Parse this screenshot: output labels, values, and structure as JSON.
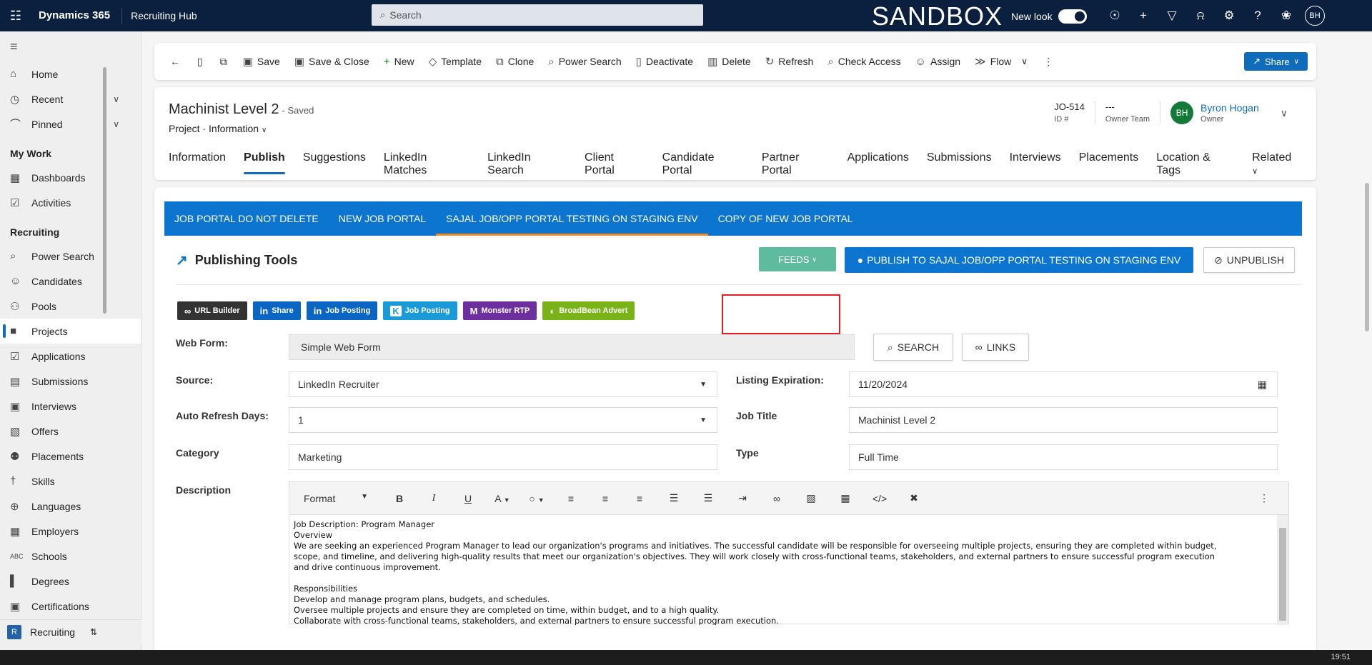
{
  "topbar": {
    "app_name": "Dynamics 365",
    "hub_name": "Recruiting Hub",
    "search_placeholder": "Search",
    "env_label": "SANDBOX",
    "new_look_label": "New look",
    "new_look_on": true,
    "user_initials": "BH"
  },
  "sidebar": {
    "items_top": [
      {
        "label": "Home",
        "icon": "home-icon"
      },
      {
        "label": "Recent",
        "icon": "clock-icon",
        "expandable": true
      },
      {
        "label": "Pinned",
        "icon": "pin-icon",
        "expandable": true
      }
    ],
    "my_work_heading": "My Work",
    "my_work_items": [
      {
        "label": "Dashboards",
        "icon": "dashboard-icon"
      },
      {
        "label": "Activities",
        "icon": "clipboard-icon"
      }
    ],
    "recruiting_heading": "Recruiting",
    "recruiting_items": [
      {
        "label": "Power Search",
        "icon": "search-icon"
      },
      {
        "label": "Candidates",
        "icon": "person-icon"
      },
      {
        "label": "Pools",
        "icon": "people-icon"
      },
      {
        "label": "Projects",
        "icon": "briefcase-icon",
        "active": true
      },
      {
        "label": "Applications",
        "icon": "checkbox-icon"
      },
      {
        "label": "Submissions",
        "icon": "id-card-icon"
      },
      {
        "label": "Interviews",
        "icon": "calendar-icon"
      },
      {
        "label": "Offers",
        "icon": "document-icon"
      },
      {
        "label": "Placements",
        "icon": "people-team-icon"
      },
      {
        "label": "Skills",
        "icon": "skills-icon"
      },
      {
        "label": "Languages",
        "icon": "globe-icon"
      },
      {
        "label": "Employers",
        "icon": "building-icon"
      },
      {
        "label": "Schools",
        "icon": "abc-icon"
      },
      {
        "label": "Degrees",
        "icon": "book-icon"
      },
      {
        "label": "Certifications",
        "icon": "certificate-icon"
      }
    ],
    "area_initial": "R",
    "area_label": "Recruiting"
  },
  "commandbar": {
    "items": [
      {
        "label": "Save",
        "icon": "save-icon"
      },
      {
        "label": "Save & Close",
        "icon": "save-close-icon"
      },
      {
        "label": "New",
        "icon": "plus-icon"
      },
      {
        "label": "Template",
        "icon": "tag-icon"
      },
      {
        "label": "Clone",
        "icon": "copy-icon"
      },
      {
        "label": "Power Search",
        "icon": "search-icon"
      },
      {
        "label": "Deactivate",
        "icon": "deactivate-icon"
      },
      {
        "label": "Delete",
        "icon": "trash-icon"
      },
      {
        "label": "Refresh",
        "icon": "refresh-icon"
      },
      {
        "label": "Check Access",
        "icon": "key-icon"
      },
      {
        "label": "Assign",
        "icon": "assign-icon"
      },
      {
        "label": "Flow",
        "icon": "flow-icon"
      }
    ],
    "share_label": "Share"
  },
  "record": {
    "title": "Machinist Level 2",
    "saved_status": "- Saved",
    "entity": "Project",
    "form": "Information",
    "id_value": "JO-514",
    "id_label": "ID #",
    "owner_team_value": "---",
    "owner_team_label": "Owner Team",
    "owner_initials": "BH",
    "owner_name": "Byron Hogan",
    "owner_label": "Owner"
  },
  "tabs": [
    "Information",
    "Publish",
    "Suggestions",
    "LinkedIn Matches",
    "LinkedIn Search",
    "Client Portal",
    "Candidate Portal",
    "Partner Portal",
    "Applications",
    "Submissions",
    "Interviews",
    "Placements",
    "Location & Tags",
    "Related"
  ],
  "active_tab": "Publish",
  "portals": {
    "tabs": [
      "JOB PORTAL DO NOT DELETE",
      "NEW JOB PORTAL",
      "SAJAL JOB/OPP PORTAL TESTING ON STAGING ENV",
      "COPY OF NEW JOB PORTAL"
    ],
    "active": "SAJAL JOB/OPP PORTAL TESTING ON STAGING ENV"
  },
  "publishing": {
    "title": "Publishing Tools",
    "feeds_label": "FEEDS",
    "publish_label": "PUBLISH TO SAJAL JOB/OPP PORTAL TESTING ON STAGING ENV",
    "unpublish_label": "UNPUBLISH",
    "tools": [
      {
        "label": "URL Builder",
        "color": "#333333",
        "icon": "link-icon"
      },
      {
        "label": "Share",
        "color": "#0a66c2",
        "icon": "linkedin-icon"
      },
      {
        "label": "Job Posting",
        "color": "#0a66c2",
        "icon": "linkedin-icon"
      },
      {
        "label": "Job Posting",
        "color": "#1a9bd7",
        "icon": "k-icon"
      },
      {
        "label": "Monster RTP",
        "color": "#6e2f9e",
        "icon": "monster-icon"
      },
      {
        "label": "BroadBean Advert",
        "color": "#7ab317",
        "icon": "toggle-icon"
      }
    ]
  },
  "form": {
    "web_form_label": "Web Form:",
    "web_form_value": "Simple Web Form",
    "search_btn": "SEARCH",
    "links_btn": "LINKS",
    "source_label": "Source:",
    "source_value": "LinkedIn Recruiter",
    "listing_exp_label": "Listing Expiration:",
    "listing_exp_value": "11/20/2024",
    "auto_refresh_label": "Auto Refresh Days:",
    "auto_refresh_value": "1",
    "job_title_label": "Job Title",
    "job_title_value": "Machinist Level 2",
    "category_label": "Category",
    "category_value": "Marketing",
    "type_label": "Type",
    "type_value": "Full Time",
    "description_label": "Description",
    "format_label": "Format",
    "description_text": "Job Description: Program Manager\nOverview\nWe are seeking an experienced Program Manager to lead our organization's programs and initiatives. The successful candidate will be responsible for overseeing multiple projects, ensuring they are completed within budget,\nscope, and timeline, and delivering high-quality results that meet our organization's objectives. They will work closely with cross-functional teams, stakeholders, and external partners to ensure successful program execution\nand drive continuous improvement.\n\nResponsibilities\nDevelop and manage program plans, budgets, and schedules.\nOversee multiple projects and ensure they are completed on time, within budget, and to a high quality.\nCollaborate with cross-functional teams, stakeholders, and external partners to ensure successful program execution.\nIdentify and manage program risks and issues, and develop mitigation plans as needed.\nMonitor and report on program progress, risks, and issues to senior management and stakeholders.\nLead and mentor project managers and project teams."
  },
  "clock": "19:51"
}
